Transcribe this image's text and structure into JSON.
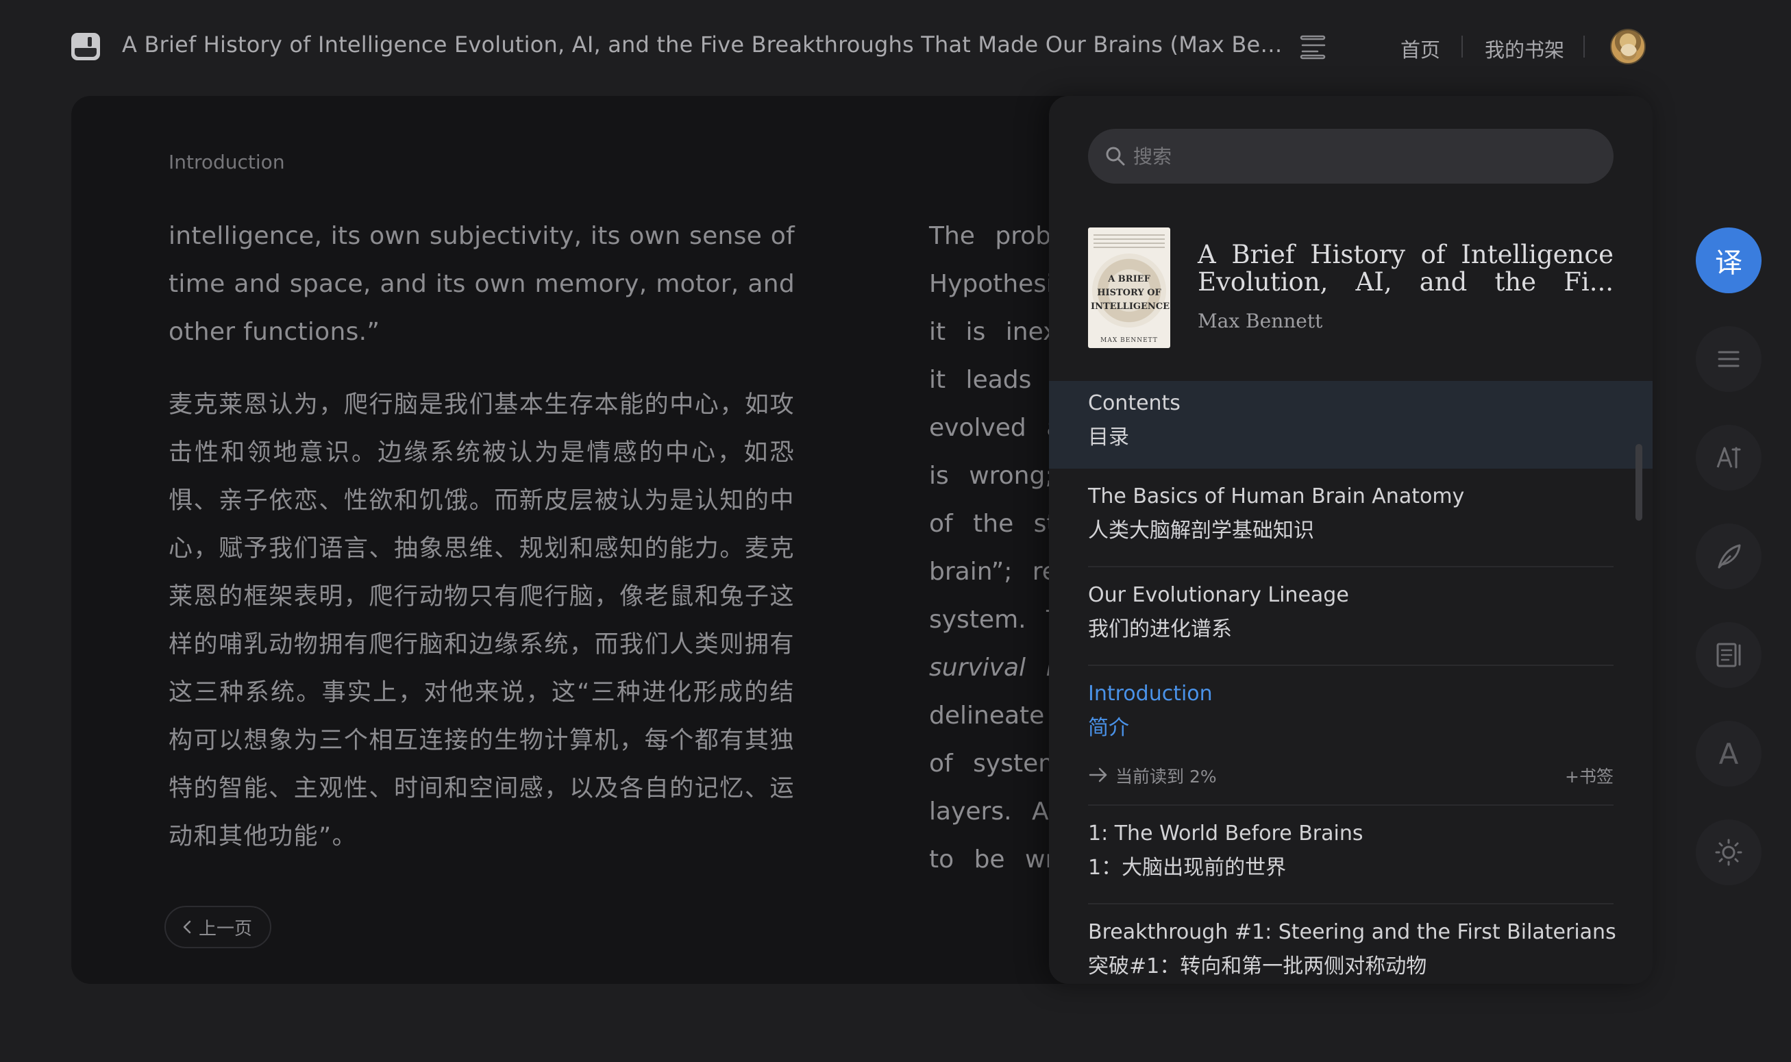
{
  "header": {
    "book_title": "A Brief History of Intelligence Evolution, AI, and the Five Breakthroughs That Made Our Brains (Max Bennett)...",
    "nav_home": "首页",
    "nav_shelf": "我的书架"
  },
  "reader": {
    "chapter_label": "Introduction",
    "left_en": "intelligence, its own subjectivity, its own sense of time and space, and its own memory, motor, and other functions.”",
    "left_zh": "麦克莱恩认为，爬行脑是我们基本生存本能的中心，如攻击性和领地意识。边缘系统被认为是情感的中心，如恐惧、亲子依恋、性欲和饥饿。而新皮层被认为是认知的中心，赋予我们语言、抽象思维、规划和感知的能力。麦克莱恩的框架表明，爬行动物只有爬行脑，像老鼠和兔子这样的哺乳动物拥有爬行脑和边缘系统，而我们人类则拥有这三种系统。事实上，对他来说，这“三种进化形成的结构可以想象为三个相互连接的生物计算机，每个都有其独特的智能、主观性、时间和空间感，以及各自的记忆、运动和其他功能”。",
    "right_lines": [
      "The prob",
      "Hypothesis",
      "it is inexac",
      "it leads to",
      "evolved an",
      "is wrong; t",
      "of the stru",
      "brain”; rep",
      "system. T",
      "survival in",
      "delineate c",
      "of system",
      "layers. And",
      "to be wron"
    ],
    "prev_label": "上一页"
  },
  "toc": {
    "search_placeholder": "搜索",
    "book_name": "A Brief History of Intelligence Evolution, AI, and the Fi...",
    "author": "Max Bennett",
    "cover_title": "A BRIEF HISTORY OF INTELLIGENCE",
    "cover_author": "MAX BENNETT",
    "items": [
      {
        "en": "Contents",
        "zh": "目录"
      },
      {
        "en": "The Basics of Human Brain Anatomy",
        "zh": "人类大脑解剖学基础知识"
      },
      {
        "en": "Our Evolutionary Lineage",
        "zh": "我们的进化谱系"
      },
      {
        "en": "Introduction",
        "zh": "简介"
      },
      {
        "en": "1: The World Before Brains",
        "zh": "1：大脑出现前的世界"
      },
      {
        "en": "Breakthrough #1: Steering and the First Bilaterians",
        "zh": "突破#1：转向和第一批两侧对称动物"
      }
    ],
    "progress_text": "当前读到 2%",
    "bookmark_label": "+书签"
  },
  "tools": {
    "translate_glyph": "译",
    "font_glyph": "A"
  },
  "colors": {
    "accent": "#3a7dde",
    "current_chapter": "#4a92e8"
  }
}
